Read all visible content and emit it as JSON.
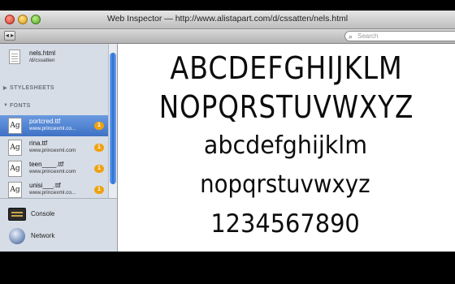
{
  "window": {
    "title": "Web Inspector — http://www.alistapart.com/d/cssatten/nels.html"
  },
  "toolbar": {
    "dock_button_glyph": "◂ ▸",
    "search": {
      "placeholder": "Search",
      "icon": "magnifier-icon"
    }
  },
  "sidebar": {
    "document": {
      "name": "nels.html",
      "path": "/d/cssatten"
    },
    "sections": {
      "stylesheets": "STYLESHEETS",
      "fonts": "FONTS"
    },
    "fonts": [
      {
        "glyph": "Ag",
        "name": "portcred.ttf",
        "url": "www.princexml.co...",
        "badge": "1",
        "selected": true
      },
      {
        "glyph": "Ag",
        "name": "rina.ttf",
        "url": "www.princexml.com",
        "badge": "1"
      },
      {
        "glyph": "Ag",
        "name": "teen____.ttf",
        "url": "www.princexml.com",
        "badge": "1"
      },
      {
        "glyph": "Ag",
        "name": "unisi___.ttf",
        "url": "www.princexml.co...",
        "badge": "1"
      }
    ],
    "panels": [
      {
        "label": "Console",
        "icon": "console-icon"
      },
      {
        "label": "Network",
        "icon": "network-icon"
      }
    ]
  },
  "content": {
    "lines": [
      "ABCDEFGHIJKLM",
      "NOPQRSTUVWXYZ",
      "abcdefghijklm",
      "nopqrstuvwxyz",
      "1234567890"
    ]
  },
  "colors": {
    "selection": "#4f80d0",
    "badge": "#f0a10f",
    "sidebar": "#d6dde6"
  }
}
